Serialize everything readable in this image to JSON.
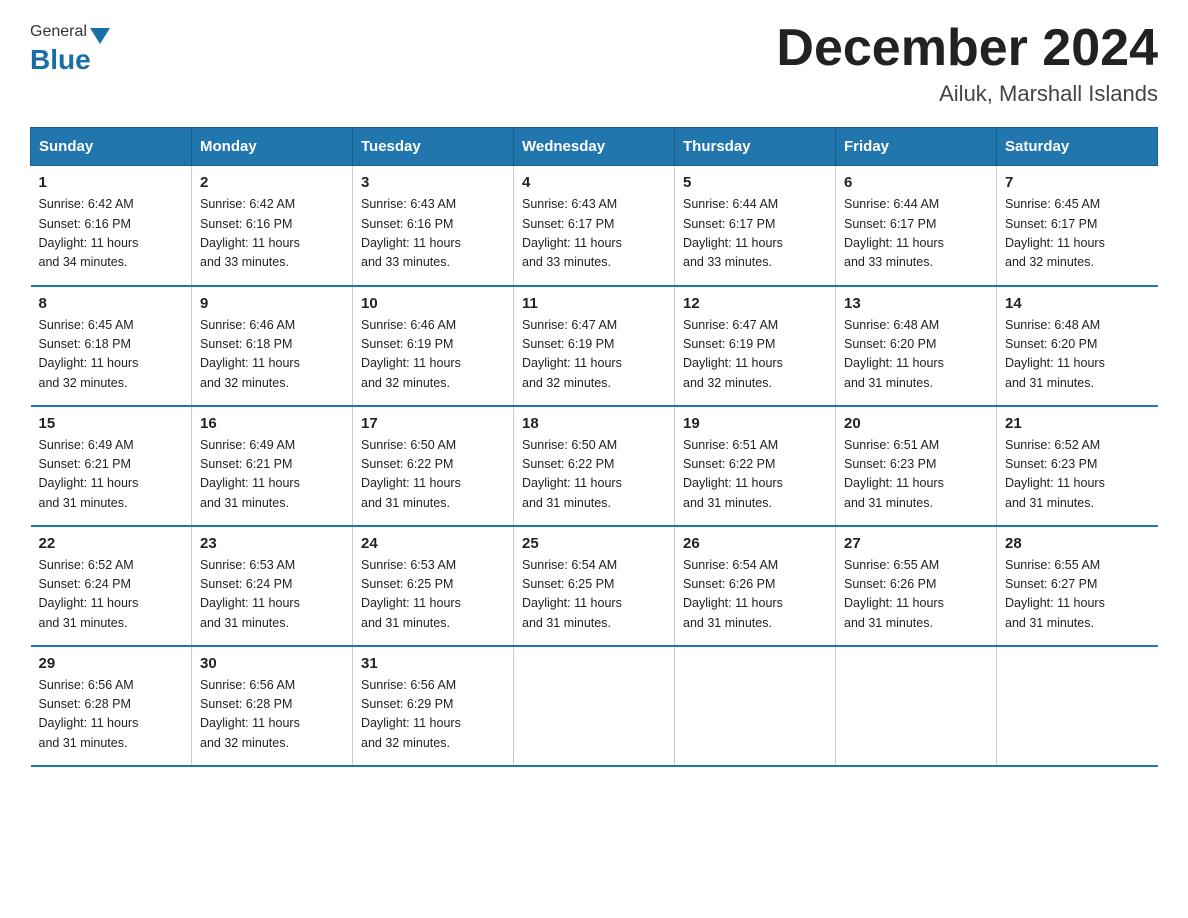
{
  "header": {
    "logo_general": "General",
    "logo_blue": "Blue",
    "month_title": "December 2024",
    "location": "Ailuk, Marshall Islands"
  },
  "weekdays": [
    "Sunday",
    "Monday",
    "Tuesday",
    "Wednesday",
    "Thursday",
    "Friday",
    "Saturday"
  ],
  "weeks": [
    [
      {
        "day": "1",
        "sunrise": "6:42 AM",
        "sunset": "6:16 PM",
        "daylight": "11 hours and 34 minutes."
      },
      {
        "day": "2",
        "sunrise": "6:42 AM",
        "sunset": "6:16 PM",
        "daylight": "11 hours and 33 minutes."
      },
      {
        "day": "3",
        "sunrise": "6:43 AM",
        "sunset": "6:16 PM",
        "daylight": "11 hours and 33 minutes."
      },
      {
        "day": "4",
        "sunrise": "6:43 AM",
        "sunset": "6:17 PM",
        "daylight": "11 hours and 33 minutes."
      },
      {
        "day": "5",
        "sunrise": "6:44 AM",
        "sunset": "6:17 PM",
        "daylight": "11 hours and 33 minutes."
      },
      {
        "day": "6",
        "sunrise": "6:44 AM",
        "sunset": "6:17 PM",
        "daylight": "11 hours and 33 minutes."
      },
      {
        "day": "7",
        "sunrise": "6:45 AM",
        "sunset": "6:17 PM",
        "daylight": "11 hours and 32 minutes."
      }
    ],
    [
      {
        "day": "8",
        "sunrise": "6:45 AM",
        "sunset": "6:18 PM",
        "daylight": "11 hours and 32 minutes."
      },
      {
        "day": "9",
        "sunrise": "6:46 AM",
        "sunset": "6:18 PM",
        "daylight": "11 hours and 32 minutes."
      },
      {
        "day": "10",
        "sunrise": "6:46 AM",
        "sunset": "6:19 PM",
        "daylight": "11 hours and 32 minutes."
      },
      {
        "day": "11",
        "sunrise": "6:47 AM",
        "sunset": "6:19 PM",
        "daylight": "11 hours and 32 minutes."
      },
      {
        "day": "12",
        "sunrise": "6:47 AM",
        "sunset": "6:19 PM",
        "daylight": "11 hours and 32 minutes."
      },
      {
        "day": "13",
        "sunrise": "6:48 AM",
        "sunset": "6:20 PM",
        "daylight": "11 hours and 31 minutes."
      },
      {
        "day": "14",
        "sunrise": "6:48 AM",
        "sunset": "6:20 PM",
        "daylight": "11 hours and 31 minutes."
      }
    ],
    [
      {
        "day": "15",
        "sunrise": "6:49 AM",
        "sunset": "6:21 PM",
        "daylight": "11 hours and 31 minutes."
      },
      {
        "day": "16",
        "sunrise": "6:49 AM",
        "sunset": "6:21 PM",
        "daylight": "11 hours and 31 minutes."
      },
      {
        "day": "17",
        "sunrise": "6:50 AM",
        "sunset": "6:22 PM",
        "daylight": "11 hours and 31 minutes."
      },
      {
        "day": "18",
        "sunrise": "6:50 AM",
        "sunset": "6:22 PM",
        "daylight": "11 hours and 31 minutes."
      },
      {
        "day": "19",
        "sunrise": "6:51 AM",
        "sunset": "6:22 PM",
        "daylight": "11 hours and 31 minutes."
      },
      {
        "day": "20",
        "sunrise": "6:51 AM",
        "sunset": "6:23 PM",
        "daylight": "11 hours and 31 minutes."
      },
      {
        "day": "21",
        "sunrise": "6:52 AM",
        "sunset": "6:23 PM",
        "daylight": "11 hours and 31 minutes."
      }
    ],
    [
      {
        "day": "22",
        "sunrise": "6:52 AM",
        "sunset": "6:24 PM",
        "daylight": "11 hours and 31 minutes."
      },
      {
        "day": "23",
        "sunrise": "6:53 AM",
        "sunset": "6:24 PM",
        "daylight": "11 hours and 31 minutes."
      },
      {
        "day": "24",
        "sunrise": "6:53 AM",
        "sunset": "6:25 PM",
        "daylight": "11 hours and 31 minutes."
      },
      {
        "day": "25",
        "sunrise": "6:54 AM",
        "sunset": "6:25 PM",
        "daylight": "11 hours and 31 minutes."
      },
      {
        "day": "26",
        "sunrise": "6:54 AM",
        "sunset": "6:26 PM",
        "daylight": "11 hours and 31 minutes."
      },
      {
        "day": "27",
        "sunrise": "6:55 AM",
        "sunset": "6:26 PM",
        "daylight": "11 hours and 31 minutes."
      },
      {
        "day": "28",
        "sunrise": "6:55 AM",
        "sunset": "6:27 PM",
        "daylight": "11 hours and 31 minutes."
      }
    ],
    [
      {
        "day": "29",
        "sunrise": "6:56 AM",
        "sunset": "6:28 PM",
        "daylight": "11 hours and 31 minutes."
      },
      {
        "day": "30",
        "sunrise": "6:56 AM",
        "sunset": "6:28 PM",
        "daylight": "11 hours and 32 minutes."
      },
      {
        "day": "31",
        "sunrise": "6:56 AM",
        "sunset": "6:29 PM",
        "daylight": "11 hours and 32 minutes."
      },
      null,
      null,
      null,
      null
    ]
  ],
  "labels": {
    "sunrise": "Sunrise:",
    "sunset": "Sunset:",
    "daylight": "Daylight:"
  }
}
